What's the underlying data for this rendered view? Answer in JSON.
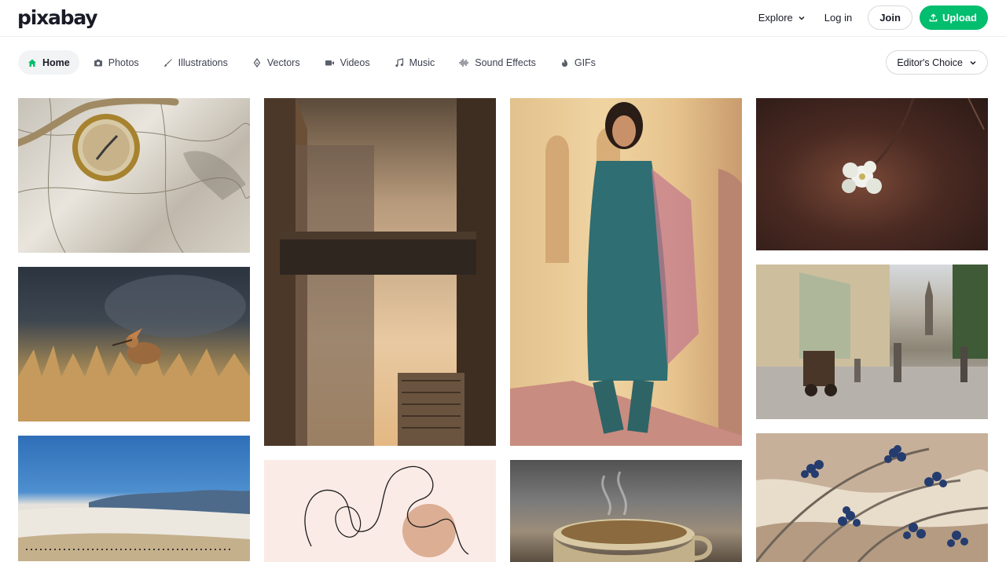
{
  "header": {
    "logo": "pixabay",
    "explore": "Explore",
    "login": "Log in",
    "join": "Join",
    "upload": "Upload"
  },
  "nav": {
    "items": [
      {
        "label": "Home",
        "icon": "home-icon"
      },
      {
        "label": "Photos",
        "icon": "camera-icon"
      },
      {
        "label": "Illustrations",
        "icon": "brush-icon"
      },
      {
        "label": "Vectors",
        "icon": "pen-nib-icon"
      },
      {
        "label": "Videos",
        "icon": "video-camera-icon"
      },
      {
        "label": "Music",
        "icon": "music-note-icon"
      },
      {
        "label": "Sound Effects",
        "icon": "waveform-icon"
      },
      {
        "label": "GIFs",
        "icon": "flame-icon"
      }
    ],
    "filter": "Editor's Choice"
  },
  "gallery": {
    "images": [
      "compass on map",
      "hoopoe bird in grass",
      "snowy field with mountains",
      "sky bridge between buildings",
      "line art face illustration",
      "woman in teal dress",
      "steaming tea cup",
      "white blossom on dark background",
      "old town street with people",
      "blue berries illustration"
    ]
  },
  "colors": {
    "brand": "#02be6e",
    "active_nav_bg": "#f1f3f5",
    "text": "#191b26"
  }
}
